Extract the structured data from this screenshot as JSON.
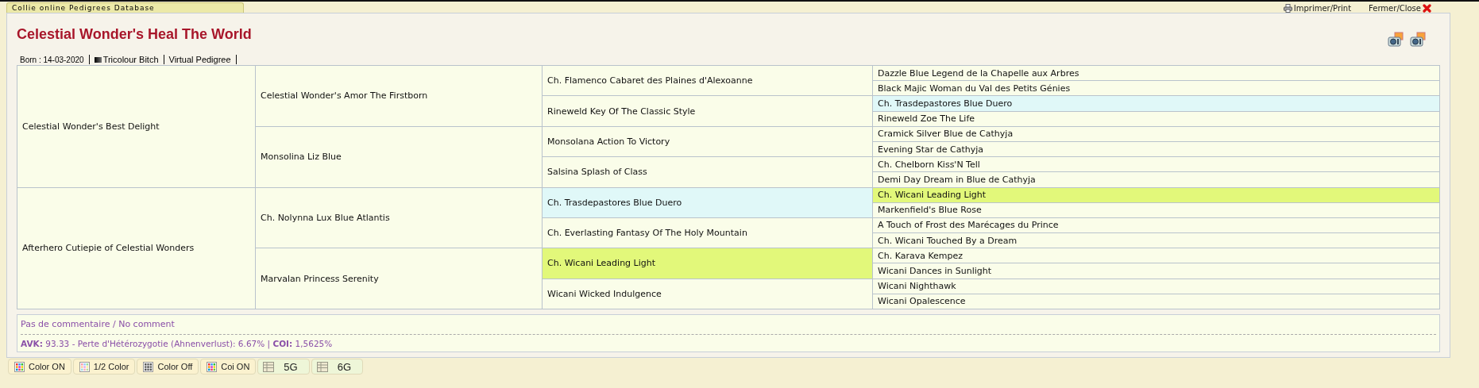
{
  "app_tab": {
    "label": "Collie online Pedigrees Database"
  },
  "top_links": [
    {
      "kind": "print",
      "label": "Imprimer/Print"
    },
    {
      "kind": "close",
      "label": "Fermer/Close"
    }
  ],
  "title": "Celestial Wonder's Heal The World",
  "info": [
    {
      "kind": "text",
      "label": "Born : 14-03-2020"
    },
    {
      "kind": "colour",
      "label": "Tricolour Bitch"
    },
    {
      "kind": "text",
      "label": "Virtual Pedigree"
    }
  ],
  "pedigree": [
    {
      "name": "Celestial Wonder's Best Delight",
      "children": [
        {
          "name": "Celestial Wonder's Amor The Firstborn",
          "children": [
            {
              "name": "Ch. Flamenco Cabaret des Plaines d'Alexoanne",
              "children": [
                {
                  "name": "Dazzle Blue Legend de la Chapelle aux Arbres"
                },
                {
                  "name": "Black Majic Woman du Val des Petits Génies"
                }
              ]
            },
            {
              "name": "Rineweld Key Of The Classic Style",
              "children": [
                {
                  "name": "Ch. Trasdepastores Blue Duero",
                  "color": "#e0f8f8"
                },
                {
                  "name": "Rineweld Zoe The Life"
                }
              ]
            }
          ]
        },
        {
          "name": "Monsolina Liz Blue",
          "children": [
            {
              "name": "Monsolana Action To Victory",
              "children": [
                {
                  "name": "Cramick Silver Blue de Cathyja"
                },
                {
                  "name": "Evening Star de Cathyja"
                }
              ]
            },
            {
              "name": "Salsina Splash of Class",
              "children": [
                {
                  "name": "Ch. Chelborn Kiss'N Tell"
                },
                {
                  "name": "Demi Day Dream in Blue de Cathyja"
                }
              ]
            }
          ]
        }
      ]
    },
    {
      "name": "Afterhero Cutiepie of Celestial Wonders",
      "children": [
        {
          "name": "Ch. Nolynna Lux Blue Atlantis",
          "children": [
            {
              "name": "Ch. Trasdepastores Blue Duero",
              "color": "#e0f8f8",
              "children": [
                {
                  "name": "Ch. Wicani Leading Light",
                  "color": "#e2f87a"
                },
                {
                  "name": "Markenfield's Blue Rose"
                }
              ]
            },
            {
              "name": "Ch. Everlasting Fantasy Of The Holy Mountain",
              "children": [
                {
                  "name": "A Touch of Frost des Marécages du Prince"
                },
                {
                  "name": "Ch. Wicani Touched By a Dream"
                }
              ]
            }
          ]
        },
        {
          "name": "Marvalan Princess Serenity",
          "children": [
            {
              "name": "Ch. Wicani Leading Light",
              "color": "#e2f87a",
              "children": [
                {
                  "name": "Ch. Karava Kempez"
                },
                {
                  "name": "Wicani Dances in Sunlight"
                }
              ]
            },
            {
              "name": "Wicani Wicked Indulgence",
              "children": [
                {
                  "name": "Wicani Nighthawk"
                },
                {
                  "name": "Wicani Opalescence"
                }
              ]
            }
          ]
        }
      ]
    }
  ],
  "comment": "Pas de commentaire / No comment",
  "stats": "**AVK:** 93.33 - Perte d'Hétérozygotie (Ahnenverlust): 6.67% | **COI:** 1,5625%",
  "buttons": [
    {
      "kind": "color",
      "label": "Color ON"
    },
    {
      "kind": "half",
      "label": "1/2 Color"
    },
    {
      "kind": "off",
      "label": "Color Off"
    },
    {
      "kind": "color",
      "label": "Coi ON"
    },
    {
      "kind": "gen",
      "label": "5G"
    },
    {
      "kind": "gen",
      "label": "6G"
    }
  ]
}
